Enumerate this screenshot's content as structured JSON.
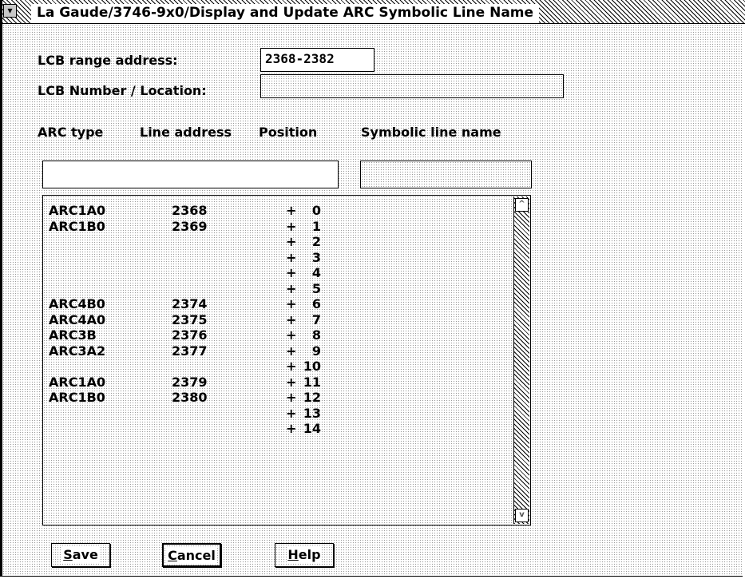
{
  "window": {
    "title": "La Gaude/3746-9x0/Display and Update ARC Symbolic Line Name",
    "sysmenu_glyph": "▾"
  },
  "form": {
    "lcb_range_label": "LCB range address:",
    "lcb_range_value": "2368-2382",
    "lcb_number_label": "LCB Number / Location:",
    "lcb_number_value": ""
  },
  "columns": {
    "arc_type": "ARC type",
    "line_address": "Line address",
    "position": "Position",
    "symbolic_name": "Symbolic line name"
  },
  "entry": {
    "left_value": "",
    "right_value": ""
  },
  "rows": [
    {
      "arc": "ARC1A0",
      "line": "2368",
      "sign": "+",
      "pos": "0"
    },
    {
      "arc": "ARC1B0",
      "line": "2369",
      "sign": "+",
      "pos": "1"
    },
    {
      "arc": "",
      "line": "",
      "sign": "+",
      "pos": "2"
    },
    {
      "arc": "",
      "line": "",
      "sign": "+",
      "pos": "3"
    },
    {
      "arc": "",
      "line": "",
      "sign": "+",
      "pos": "4"
    },
    {
      "arc": "",
      "line": "",
      "sign": "+",
      "pos": "5"
    },
    {
      "arc": "ARC4B0",
      "line": "2374",
      "sign": "+",
      "pos": "6"
    },
    {
      "arc": "ARC4A0",
      "line": "2375",
      "sign": "+",
      "pos": "7"
    },
    {
      "arc": "ARC3B",
      "line": "2376",
      "sign": "+",
      "pos": "8"
    },
    {
      "arc": "ARC3A2",
      "line": "2377",
      "sign": "+",
      "pos": "9"
    },
    {
      "arc": "",
      "line": "",
      "sign": "+",
      "pos": "10"
    },
    {
      "arc": "ARC1A0",
      "line": "2379",
      "sign": "+",
      "pos": "11"
    },
    {
      "arc": "ARC1B0",
      "line": "2380",
      "sign": "+",
      "pos": "12"
    },
    {
      "arc": "",
      "line": "",
      "sign": "+",
      "pos": "13"
    },
    {
      "arc": "",
      "line": "",
      "sign": "+",
      "pos": "14"
    }
  ],
  "scrollbar": {
    "up_glyph": "^",
    "down_glyph": "v"
  },
  "buttons": {
    "save_mnemonic": "S",
    "save_rest": "ave",
    "cancel_mnemonic": "C",
    "cancel_rest": "ancel",
    "help_mnemonic": "H",
    "help_rest": "elp"
  }
}
